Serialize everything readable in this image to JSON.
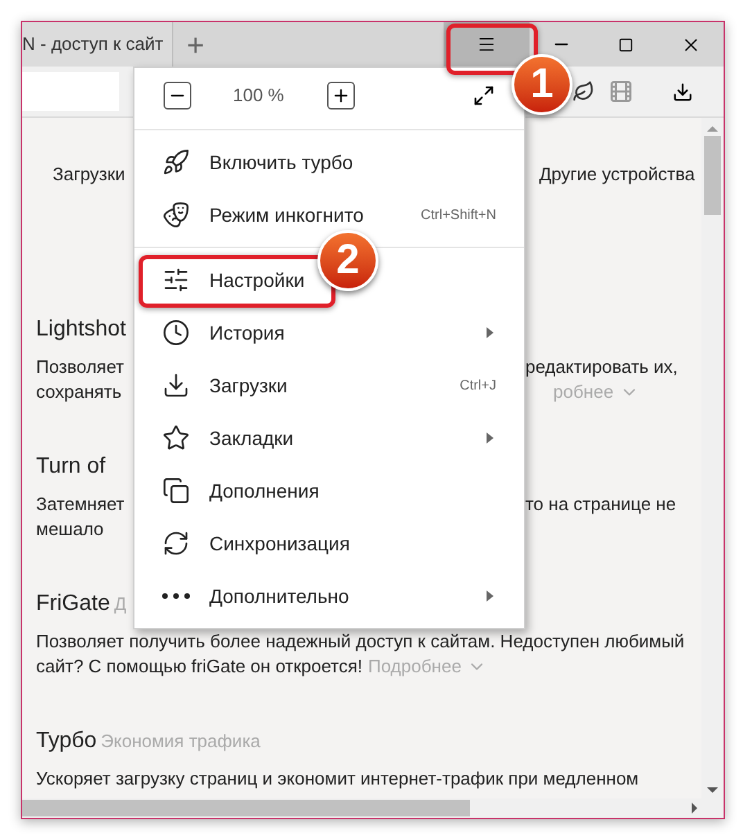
{
  "tab": {
    "title": "N - доступ к сайт",
    "new_tab": "+"
  },
  "top_links": {
    "left": "Загрузки",
    "right": "Другие устройства"
  },
  "extensions": [
    {
      "title": "Lightshot",
      "lines": [
        {
          "left": "Позволяет",
          "right": "редактировать их,"
        },
        {
          "left": "сохранять",
          "right": "робнее",
          "right_more": true
        }
      ]
    },
    {
      "title": "Turn of",
      "lines": [
        {
          "left": "Затемняет",
          "right": "то на странице не"
        },
        {
          "left": "мешало"
        }
      ]
    },
    {
      "title": "FriGate",
      "subtitle": "Д",
      "lines": [
        {
          "left": "Позволяет получить более надежный доступ к сайтам. Недоступен любимый"
        },
        {
          "left": "сайт? С помощью friGate он откроется!",
          "left_more": "Подробнее"
        }
      ]
    },
    {
      "title": "Турбо",
      "subtitle": "Экономия трафика",
      "lines": [
        {
          "left": "Ускоряет загрузку страниц и экономит интернет-трафик при медленном"
        }
      ]
    }
  ],
  "menu": {
    "zoom": "100 %",
    "items": [
      {
        "kind": "divider"
      },
      {
        "kind": "item",
        "label": "Включить турбо",
        "submenu": false,
        "highlighted": false
      },
      {
        "kind": "item",
        "label": "Режим инкогнито",
        "shortcut": "Ctrl+Shift+N",
        "submenu": false,
        "highlighted": false
      },
      {
        "kind": "divider"
      },
      {
        "kind": "item",
        "label": "Настройки",
        "submenu": false,
        "highlighted": true
      },
      {
        "kind": "item",
        "label": "История",
        "submenu": true,
        "highlighted": false
      },
      {
        "kind": "item",
        "label": "Загрузки",
        "shortcut": "Ctrl+J",
        "submenu": false,
        "highlighted": false
      },
      {
        "kind": "item",
        "label": "Закладки",
        "submenu": true,
        "highlighted": false
      },
      {
        "kind": "item",
        "label": "Дополнения",
        "submenu": false,
        "highlighted": false
      },
      {
        "kind": "item",
        "label": "Синхронизация",
        "submenu": false,
        "highlighted": false
      },
      {
        "kind": "item",
        "label": "Дополнительно",
        "submenu": true,
        "highlighted": false
      }
    ]
  },
  "callouts": [
    "1",
    "2"
  ]
}
